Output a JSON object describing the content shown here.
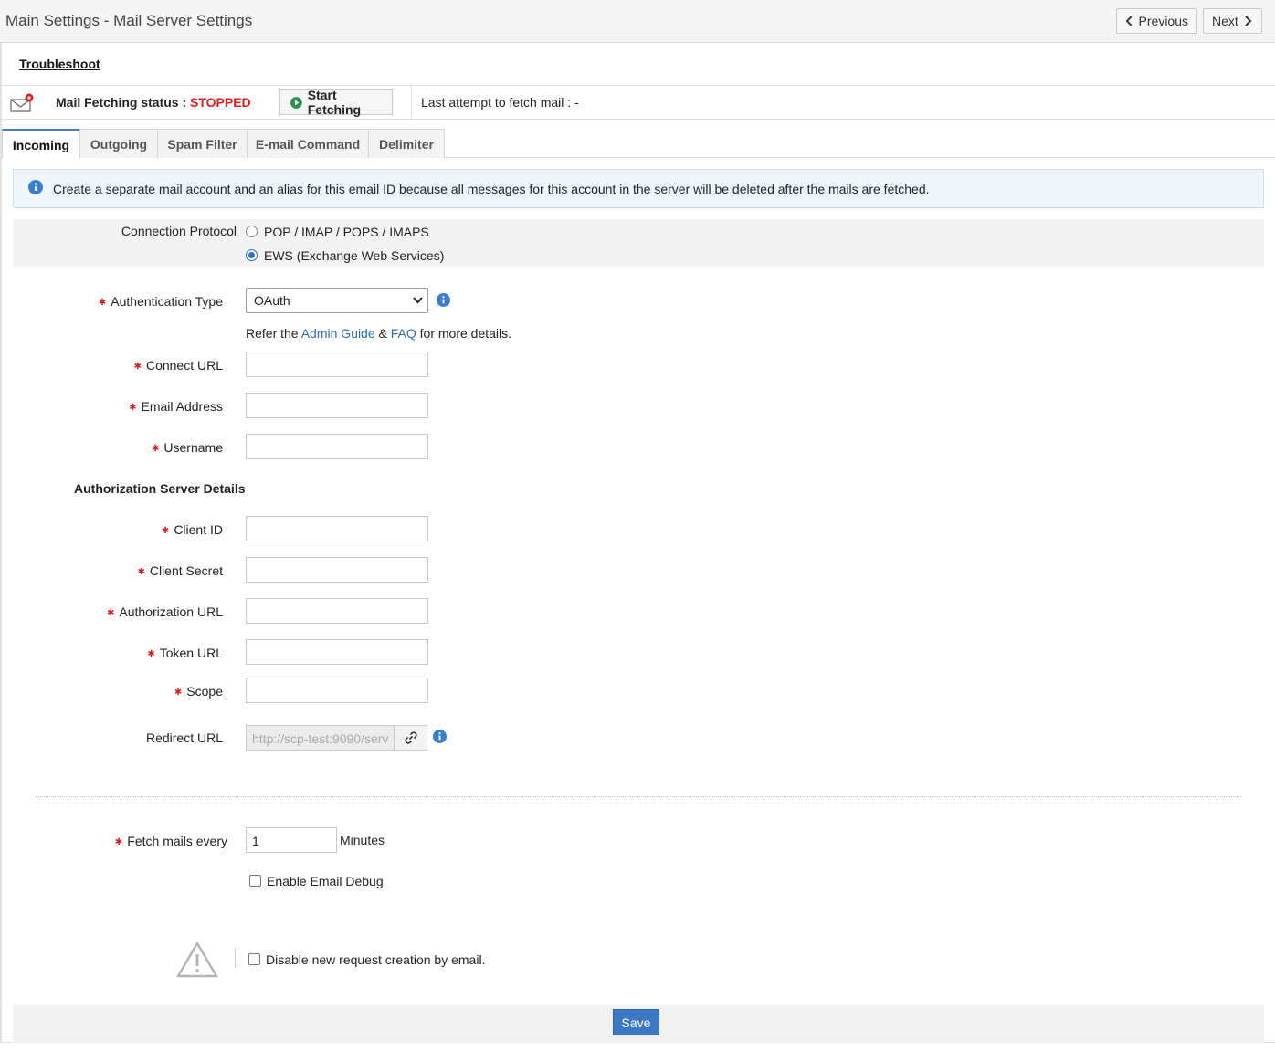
{
  "header": {
    "title": "Main Settings - Mail Server Settings",
    "previous_label": "Previous",
    "next_label": "Next"
  },
  "troubleshoot_label": "Troubleshoot",
  "status": {
    "label": "Mail Fetching status : ",
    "value": "STOPPED",
    "start_button": "Start Fetching",
    "last_attempt": "Last attempt to fetch mail : -",
    "colors": {
      "stopped": "#e02020",
      "start_icon": "#2f8f4f"
    }
  },
  "tabs": [
    {
      "label": "Incoming",
      "active": true
    },
    {
      "label": "Outgoing",
      "active": false
    },
    {
      "label": "Spam Filter",
      "active": false
    },
    {
      "label": "E-mail Command",
      "active": false
    },
    {
      "label": "Delimiter",
      "active": false
    }
  ],
  "info": {
    "text": "Create a separate mail account and an alias for this email ID because all messages for this account in the server will be deleted after the mails are fetched.",
    "icon": "info-icon"
  },
  "form": {
    "connection_protocol_label": "Connection Protocol",
    "protocol_options": [
      "POP / IMAP / POPS / IMAPS",
      "EWS (Exchange Web Services)"
    ],
    "protocol_selected": "EWS (Exchange Web Services)",
    "auth_type_label": "Authentication Type",
    "auth_type_value": "OAuth",
    "refer_prefix": "Refer the ",
    "admin_guide": "Admin Guide",
    "ampersand": " & ",
    "faq": "FAQ",
    "refer_suffix": " for more details.",
    "connect_url_label": "Connect URL",
    "email_address_label": "Email Address",
    "username_label": "Username",
    "auth_server_section": "Authorization Server Details",
    "client_id_label": "Client ID",
    "client_secret_label": "Client Secret",
    "authorization_url_label": "Authorization URL",
    "token_url_label": "Token URL",
    "scope_label": "Scope",
    "redirect_url_label": "Redirect URL",
    "redirect_url_value": "http://scp-test:9090/serv",
    "fetch_label": "Fetch mails every",
    "fetch_value": "1",
    "fetch_unit": "Minutes",
    "enable_debug_label": "Enable Email Debug",
    "enable_debug_checked": false,
    "disable_creation_label": "Disable new request creation by email.",
    "disable_creation_checked": false
  },
  "save_label": "Save",
  "colors": {
    "accent": "#3c78c3",
    "required": "#d42020",
    "link": "#2d6db5"
  }
}
